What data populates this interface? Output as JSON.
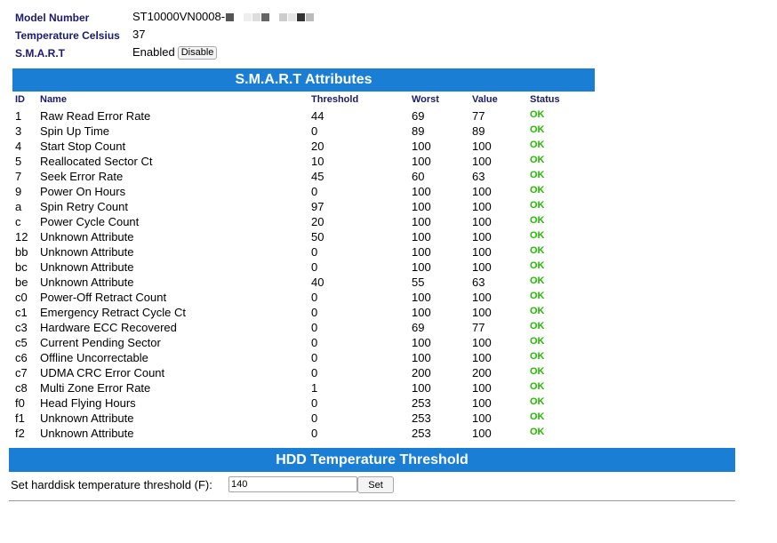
{
  "device": {
    "model_label": "Model Number",
    "model_value": "ST10000VN0008-",
    "temp_label": "Temperature Celsius",
    "temp_value": "37",
    "smart_label": "S.M.A.R.T",
    "smart_value": "Enabled",
    "smart_toggle_label": "Disable"
  },
  "smart_attributes": {
    "title": "S.M.A.R.T Attributes",
    "columns": {
      "id": "ID",
      "name": "Name",
      "threshold": "Threshold",
      "worst": "Worst",
      "value": "Value",
      "status": "Status"
    },
    "rows": [
      {
        "id": "1",
        "name": "Raw Read Error Rate",
        "threshold": "44",
        "worst": "69",
        "value": "77",
        "status": "OK"
      },
      {
        "id": "3",
        "name": "Spin Up Time",
        "threshold": "0",
        "worst": "89",
        "value": "89",
        "status": "OK"
      },
      {
        "id": "4",
        "name": "Start Stop Count",
        "threshold": "20",
        "worst": "100",
        "value": "100",
        "status": "OK"
      },
      {
        "id": "5",
        "name": "Reallocated Sector Ct",
        "threshold": "10",
        "worst": "100",
        "value": "100",
        "status": "OK"
      },
      {
        "id": "7",
        "name": "Seek Error Rate",
        "threshold": "45",
        "worst": "60",
        "value": "63",
        "status": "OK"
      },
      {
        "id": "9",
        "name": "Power On Hours",
        "threshold": "0",
        "worst": "100",
        "value": "100",
        "status": "OK"
      },
      {
        "id": "a",
        "name": "Spin Retry Count",
        "threshold": "97",
        "worst": "100",
        "value": "100",
        "status": "OK"
      },
      {
        "id": "c",
        "name": "Power Cycle Count",
        "threshold": "20",
        "worst": "100",
        "value": "100",
        "status": "OK"
      },
      {
        "id": "12",
        "name": "Unknown Attribute",
        "threshold": "50",
        "worst": "100",
        "value": "100",
        "status": "OK"
      },
      {
        "id": "bb",
        "name": "Unknown Attribute",
        "threshold": "0",
        "worst": "100",
        "value": "100",
        "status": "OK"
      },
      {
        "id": "bc",
        "name": "Unknown Attribute",
        "threshold": "0",
        "worst": "100",
        "value": "100",
        "status": "OK"
      },
      {
        "id": "be",
        "name": "Unknown Attribute",
        "threshold": "40",
        "worst": "55",
        "value": "63",
        "status": "OK"
      },
      {
        "id": "c0",
        "name": "Power-Off Retract Count",
        "threshold": "0",
        "worst": "100",
        "value": "100",
        "status": "OK"
      },
      {
        "id": "c1",
        "name": "Emergency Retract Cycle Ct",
        "threshold": "0",
        "worst": "100",
        "value": "100",
        "status": "OK"
      },
      {
        "id": "c3",
        "name": "Hardware ECC Recovered",
        "threshold": "0",
        "worst": "69",
        "value": "77",
        "status": "OK"
      },
      {
        "id": "c5",
        "name": "Current Pending Sector",
        "threshold": "0",
        "worst": "100",
        "value": "100",
        "status": "OK"
      },
      {
        "id": "c6",
        "name": "Offline Uncorrectable",
        "threshold": "0",
        "worst": "100",
        "value": "100",
        "status": "OK"
      },
      {
        "id": "c7",
        "name": "UDMA CRC Error Count",
        "threshold": "0",
        "worst": "200",
        "value": "200",
        "status": "OK"
      },
      {
        "id": "c8",
        "name": "Multi Zone Error Rate",
        "threshold": "1",
        "worst": "100",
        "value": "100",
        "status": "OK"
      },
      {
        "id": "f0",
        "name": "Head Flying Hours",
        "threshold": "0",
        "worst": "253",
        "value": "100",
        "status": "OK"
      },
      {
        "id": "f1",
        "name": "Unknown Attribute",
        "threshold": "0",
        "worst": "253",
        "value": "100",
        "status": "OK"
      },
      {
        "id": "f2",
        "name": "Unknown Attribute",
        "threshold": "0",
        "worst": "253",
        "value": "100",
        "status": "OK"
      }
    ]
  },
  "temperature_threshold": {
    "title": "HDD Temperature Threshold",
    "label": "Set harddisk temperature threshold (F):",
    "value": "140",
    "button": "Set"
  },
  "colors": {
    "banner": "#1a7fd4",
    "label_text": "#1a1a6e",
    "status_ok": "#22bb00"
  }
}
